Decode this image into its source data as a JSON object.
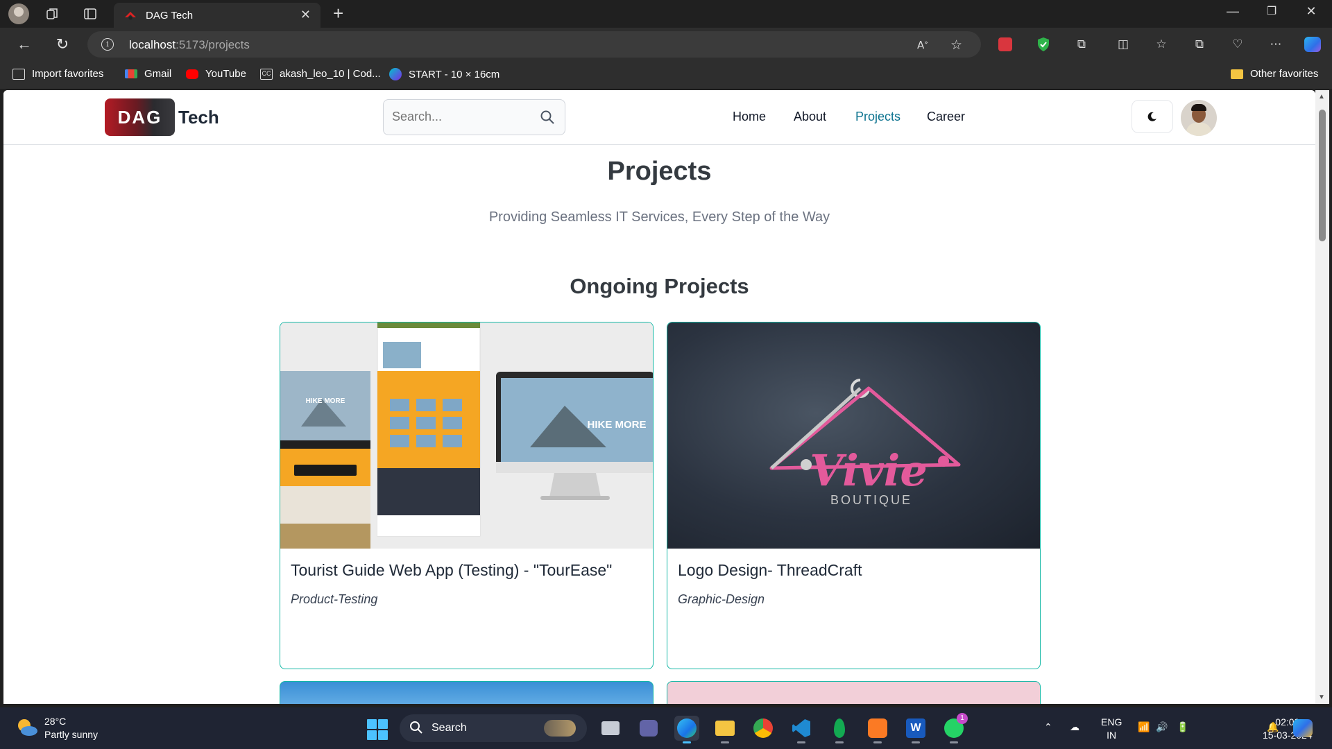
{
  "browser": {
    "tab_title": "DAG Tech",
    "url_host": "localhost",
    "url_path": ":5173/projects",
    "favorites": [
      {
        "label": "Import favorites",
        "icon": "import-icon"
      },
      {
        "label": "Gmail",
        "icon": "gmail-icon"
      },
      {
        "label": "YouTube",
        "icon": "youtube-icon"
      },
      {
        "label": "akash_leo_10 | Cod...",
        "icon": "codechef-icon"
      },
      {
        "label": "START - 10 × 16cm",
        "icon": "canva-icon"
      }
    ],
    "other_favorites": "Other favorites"
  },
  "site": {
    "logo_box": "DAG",
    "logo_text": "Tech",
    "search_placeholder": "Search...",
    "menu": [
      {
        "label": "Home",
        "active": false
      },
      {
        "label": "About",
        "active": false
      },
      {
        "label": "Projects",
        "active": true
      },
      {
        "label": "Career",
        "active": false
      }
    ],
    "accent_color": "#0e7490"
  },
  "page": {
    "title": "Projects",
    "subtitle": "Providing Seamless IT Services, Every Step of the Way",
    "section_title": "Ongoing Projects",
    "projects": [
      {
        "title": "Tourist Guide Web App (Testing) - \"TourEase\"",
        "tag": "Product-Testing",
        "image_text": "HIKE MORE"
      },
      {
        "title": "Logo Design- ThreadCraft",
        "tag": "Graphic-Design",
        "image_text": "Vivie",
        "image_subtext": "BOUTIQUE"
      }
    ]
  },
  "taskbar": {
    "temperature": "28°C",
    "weather": "Partly sunny",
    "search_label": "Search",
    "lang_top": "ENG",
    "lang_bottom": "IN",
    "time": "02:09",
    "date": "15-03-2024",
    "whatsapp_badge": "1"
  }
}
